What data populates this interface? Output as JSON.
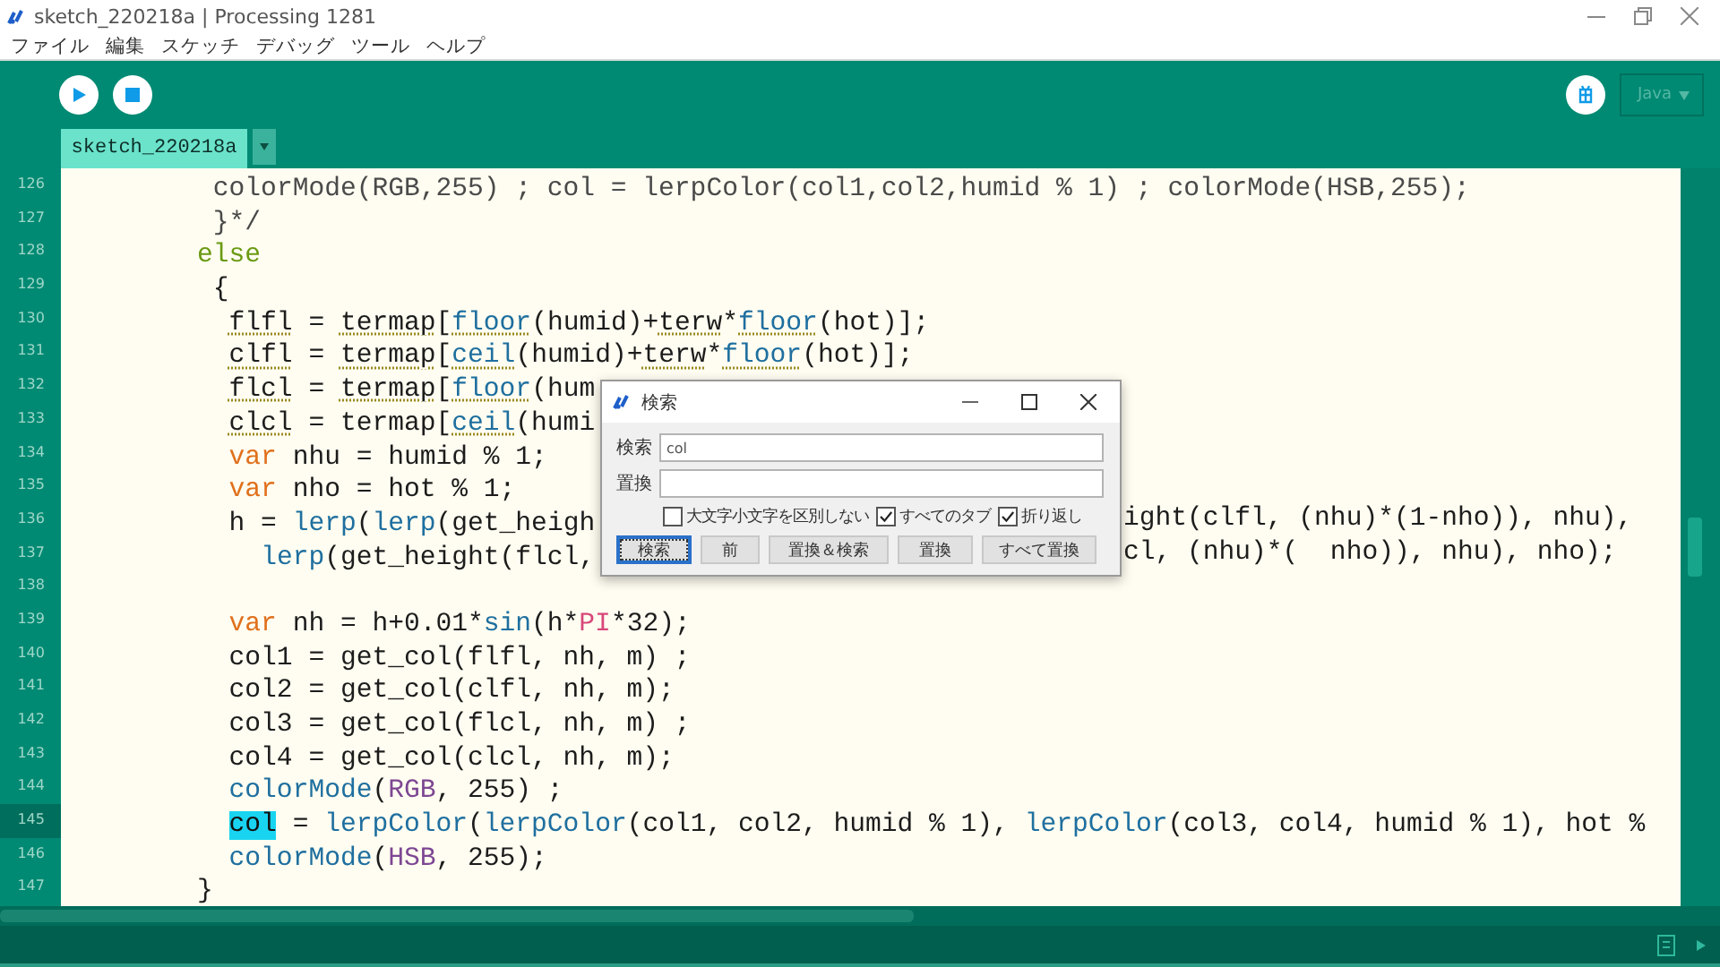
{
  "window": {
    "title": "sketch_220218a | Processing 1281"
  },
  "menu": [
    "ファイル",
    "編集",
    "スケッチ",
    "デバッグ",
    "ツール",
    "ヘルプ"
  ],
  "toolbar": {
    "mode": "Java"
  },
  "tabs": [
    {
      "label": "sketch_220218a",
      "selected": true
    }
  ],
  "editor": {
    "lines": [
      {
        "number": "126",
        "current": false,
        "tokens": [
          {
            "text": "         colorMode(RGB,255) ; col = lerpColor(col1,col2,humid % 1) ; colorMode(HSB,255);",
            "kind": "comment",
            "warning": false
          }
        ]
      },
      {
        "number": "127",
        "current": false,
        "tokens": [
          {
            "text": "         }*/",
            "kind": "comment",
            "warning": false
          }
        ]
      },
      {
        "number": "128",
        "current": false,
        "tokens": [
          {
            "text": "        else",
            "kind": "control",
            "warning": false
          }
        ]
      },
      {
        "number": "129",
        "current": false,
        "tokens": [
          {
            "text": "         {",
            "kind": "plain",
            "warning": false
          }
        ]
      },
      {
        "number": "130",
        "current": false,
        "tokens": [
          {
            "text": "          flfl",
            "kind": "plain",
            "warning": true
          },
          {
            "text": " = ",
            "kind": "plain",
            "warning": false
          },
          {
            "text": "termap",
            "kind": "plain",
            "warning": true
          },
          {
            "text": "[",
            "kind": "plain",
            "warning": false
          },
          {
            "text": "floor",
            "kind": "function",
            "warning": true
          },
          {
            "text": "(humid)+",
            "kind": "plain",
            "warning": false
          },
          {
            "text": "terw",
            "kind": "plain",
            "warning": true
          },
          {
            "text": "*",
            "kind": "plain",
            "warning": false
          },
          {
            "text": "floor",
            "kind": "function",
            "warning": true
          },
          {
            "text": "(hot)];",
            "kind": "plain",
            "warning": false
          }
        ]
      },
      {
        "number": "131",
        "current": false,
        "tokens": [
          {
            "text": "          clfl",
            "kind": "plain",
            "warning": true
          },
          {
            "text": " = ",
            "kind": "plain",
            "warning": false
          },
          {
            "text": "termap",
            "kind": "plain",
            "warning": true
          },
          {
            "text": "[",
            "kind": "plain",
            "warning": false
          },
          {
            "text": "ceil",
            "kind": "function",
            "warning": true
          },
          {
            "text": "(humid)+",
            "kind": "plain",
            "warning": false
          },
          {
            "text": "terw",
            "kind": "plain",
            "warning": true
          },
          {
            "text": "*",
            "kind": "plain",
            "warning": false
          },
          {
            "text": "floor",
            "kind": "function",
            "warning": true
          },
          {
            "text": "(hot)];",
            "kind": "plain",
            "warning": false
          }
        ]
      },
      {
        "number": "132",
        "current": false,
        "tokens": [
          {
            "text": "          flcl",
            "kind": "plain",
            "warning": true
          },
          {
            "text": " = ",
            "kind": "plain",
            "warning": false
          },
          {
            "text": "termap",
            "kind": "plain",
            "warning": true
          },
          {
            "text": "[",
            "kind": "plain",
            "warning": false
          },
          {
            "text": "floor",
            "kind": "function",
            "warning": true
          },
          {
            "text": "(hum",
            "kind": "plain",
            "warning": false
          }
        ]
      },
      {
        "number": "133",
        "current": false,
        "tokens": [
          {
            "text": "          clcl",
            "kind": "plain",
            "warning": true
          },
          {
            "text": " = termap[",
            "kind": "plain",
            "warning": false
          },
          {
            "text": "ceil",
            "kind": "function",
            "warning": true
          },
          {
            "text": "(humi",
            "kind": "plain",
            "warning": false
          }
        ]
      },
      {
        "number": "134",
        "current": false,
        "tokens": [
          {
            "text": "          var",
            "kind": "keyword",
            "warning": false
          },
          {
            "text": " nhu = humid % 1;",
            "kind": "plain",
            "warning": false
          }
        ]
      },
      {
        "number": "135",
        "current": false,
        "tokens": [
          {
            "text": "          var",
            "kind": "keyword",
            "warning": false
          },
          {
            "text": " nho = hot % 1;",
            "kind": "plain",
            "warning": false
          }
        ]
      },
      {
        "number": "136",
        "current": false,
        "tokens": [
          {
            "text": "          h = ",
            "kind": "plain",
            "warning": false
          },
          {
            "text": "lerp",
            "kind": "function",
            "warning": false
          },
          {
            "text": "(",
            "kind": "plain",
            "warning": false
          },
          {
            "text": "lerp",
            "kind": "function",
            "warning": false
          },
          {
            "text": "(get_heigh",
            "kind": "plain",
            "warning": false
          }
        ],
        "after_dialog": "ight(clfl, (nhu)*(1-nho)), nhu),"
      },
      {
        "number": "137",
        "current": false,
        "tokens": [
          {
            "text": "            lerp",
            "kind": "function",
            "warning": false
          },
          {
            "text": "(get_height(flcl,",
            "kind": "plain",
            "warning": false
          }
        ],
        "after_dialog": "cl, (nhu)*(  nho)), nhu), nho);"
      },
      {
        "number": "138",
        "current": false
      },
      {
        "number": "139",
        "current": false,
        "tokens": [
          {
            "text": "          var",
            "kind": "keyword",
            "warning": false
          },
          {
            "text": " nh = h+0.01*",
            "kind": "plain",
            "warning": false
          },
          {
            "text": "sin",
            "kind": "function",
            "warning": false
          },
          {
            "text": "(h*",
            "kind": "plain",
            "warning": false
          },
          {
            "text": "PI",
            "kind": "constant",
            "warning": false
          },
          {
            "text": "*32);",
            "kind": "plain",
            "warning": false
          }
        ]
      },
      {
        "number": "140",
        "current": false,
        "tokens": [
          {
            "text": "          col1 = get_col(flfl, nh, m) ;",
            "kind": "plain",
            "warning": false
          }
        ]
      },
      {
        "number": "141",
        "current": false,
        "tokens": [
          {
            "text": "          col2 = get_col(clfl, nh, m);",
            "kind": "plain",
            "warning": false
          }
        ]
      },
      {
        "number": "142",
        "current": false,
        "tokens": [
          {
            "text": "          col3 = get_col(flcl, nh, m) ;",
            "kind": "plain",
            "warning": false
          }
        ]
      },
      {
        "number": "143",
        "current": false,
        "tokens": [
          {
            "text": "          col4 = get_col(clcl, nh, m);",
            "kind": "plain",
            "warning": false
          }
        ]
      },
      {
        "number": "144",
        "current": false,
        "tokens": [
          {
            "text": "          colorMode",
            "kind": "function",
            "warning": false
          },
          {
            "text": "(",
            "kind": "plain",
            "warning": false
          },
          {
            "text": "RGB",
            "kind": "literal",
            "warning": false
          },
          {
            "text": ", 255) ;",
            "kind": "plain",
            "warning": false
          }
        ]
      },
      {
        "number": "145",
        "current": true,
        "tokens": [
          {
            "text": "          col",
            "kind": "match",
            "warning": false
          },
          {
            "text": " = ",
            "kind": "plain",
            "warning": false
          },
          {
            "text": "lerpColor",
            "kind": "function",
            "warning": false
          },
          {
            "text": "(",
            "kind": "plain",
            "warning": false
          },
          {
            "text": "lerpColor",
            "kind": "function",
            "warning": false
          },
          {
            "text": "(col1, col2, humid % 1), ",
            "kind": "plain",
            "warning": false
          },
          {
            "text": "lerpColor",
            "kind": "function",
            "warning": false
          },
          {
            "text": "(col3, col4, humid % 1), hot %",
            "kind": "plain",
            "warning": false
          }
        ]
      },
      {
        "number": "146",
        "current": false,
        "tokens": [
          {
            "text": "          colorMode",
            "kind": "function",
            "warning": false
          },
          {
            "text": "(",
            "kind": "plain",
            "warning": false
          },
          {
            "text": "HSB",
            "kind": "literal",
            "warning": false
          },
          {
            "text": ", 255);",
            "kind": "plain",
            "warning": false
          }
        ]
      },
      {
        "number": "147",
        "current": false,
        "tokens": [
          {
            "text": "        }",
            "kind": "plain",
            "warning": false
          }
        ]
      }
    ]
  },
  "find_dialog": {
    "title": "検索",
    "find_label": "検索",
    "find_value": "col",
    "replace_label": "置換",
    "options": [
      {
        "label": "大文字小文字を区別しない",
        "checked": false
      },
      {
        "label": "すべてのタブ",
        "checked": true
      },
      {
        "label": "折り返し",
        "checked": true
      }
    ],
    "buttons": [
      {
        "label": "検索",
        "default": true
      },
      {
        "label": "前",
        "default": false
      },
      {
        "label": "置換＆検索",
        "default": false
      },
      {
        "label": "置換",
        "default": false
      },
      {
        "label": "すべて置換",
        "default": false
      }
    ]
  }
}
